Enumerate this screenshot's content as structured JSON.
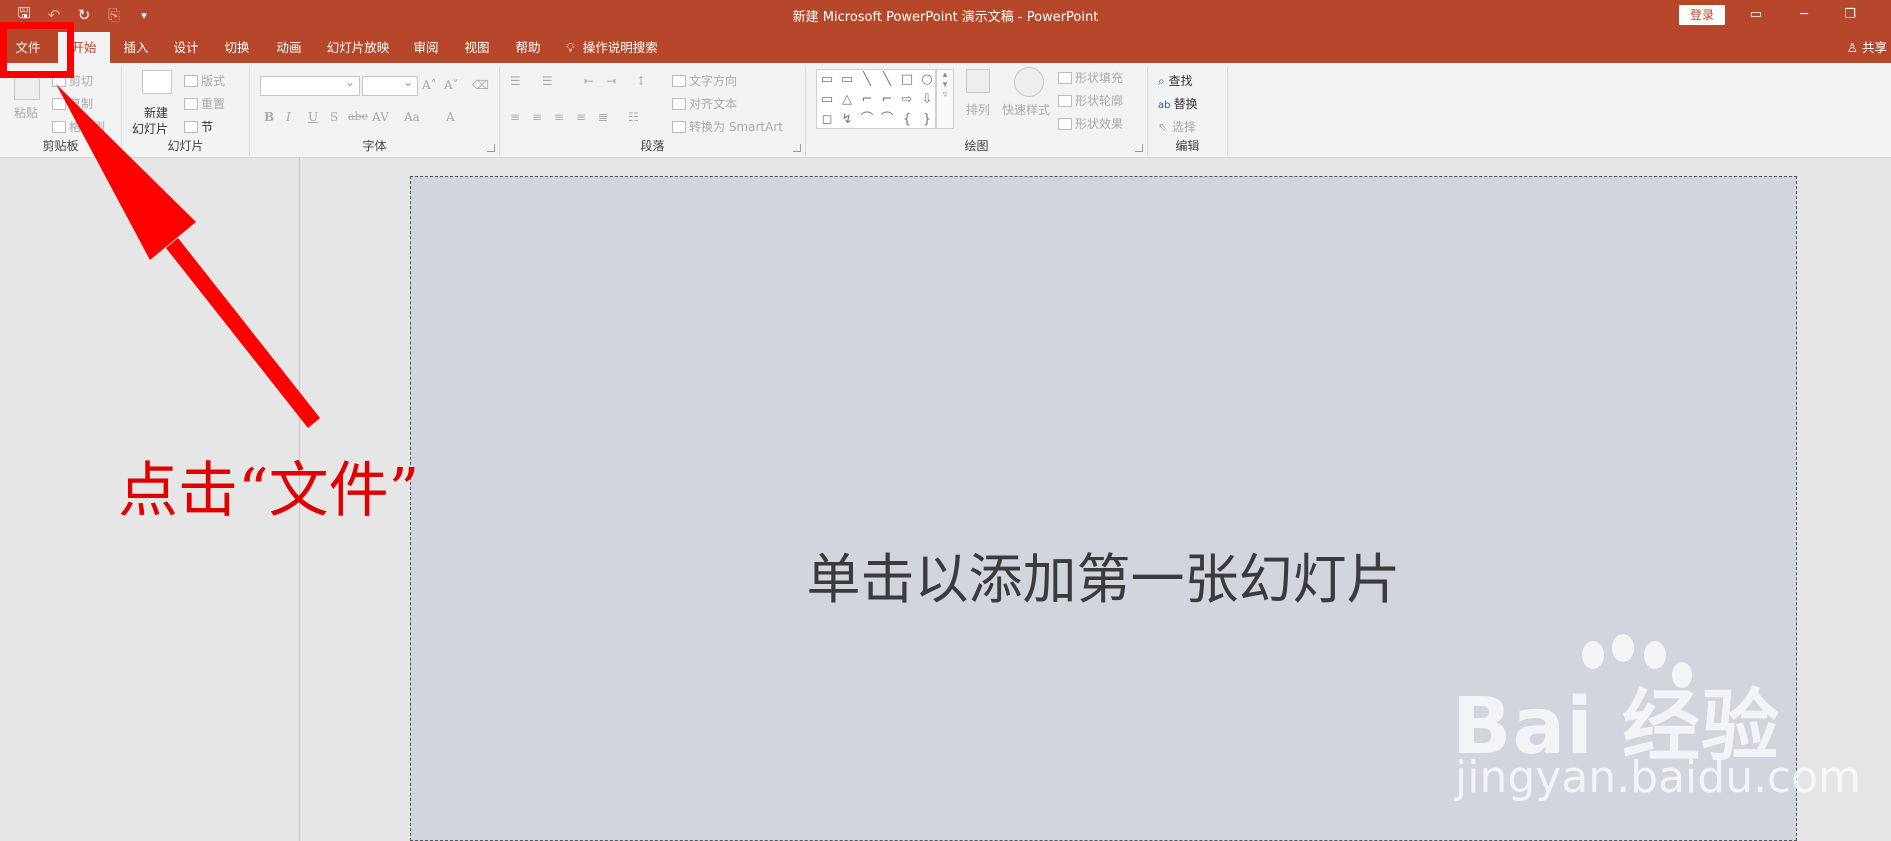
{
  "window": {
    "title": "新建 Microsoft PowerPoint 演示文稿 - PowerPoint",
    "login_label": "登录",
    "minimize": "─",
    "restore": "❐",
    "ribbon_display": "▭"
  },
  "qat": {
    "save_icon": "🖫",
    "undo_icon": "↶",
    "redo_icon": "↻",
    "start_icon": "⎘",
    "customize_icon": "▾"
  },
  "tabs": [
    {
      "label": "文件"
    },
    {
      "label": "开始"
    },
    {
      "label": "插入"
    },
    {
      "label": "设计"
    },
    {
      "label": "切换"
    },
    {
      "label": "动画"
    },
    {
      "label": "幻灯片放映"
    },
    {
      "label": "审阅"
    },
    {
      "label": "视图"
    },
    {
      "label": "帮助"
    }
  ],
  "tell_me": {
    "icon": "lightbulb-icon",
    "label": "操作说明搜索"
  },
  "share_label": "共享",
  "ribbon": {
    "clipboard": {
      "label": "剪贴板",
      "paste": "粘贴",
      "cut": "剪切",
      "copy": "复制",
      "format_painter": "格式刷"
    },
    "slides": {
      "label": "幻灯片",
      "new_slide_line1": "新建",
      "new_slide_line2": "幻灯片",
      "layout": "版式",
      "reset": "重置",
      "section": "节"
    },
    "font": {
      "label": "字体",
      "increase": "A˄",
      "decrease": "A˅",
      "bold": "B",
      "italic": "I",
      "underline": "U",
      "shadow": "S",
      "strike": "abc",
      "spacing": "AV",
      "case": "Aa",
      "color": "A"
    },
    "paragraph": {
      "label": "段落",
      "text_direction": "文字方向",
      "align_text": "对齐文本",
      "smartart": "转换为 SmartArt"
    },
    "drawing": {
      "label": "绘图",
      "arrange": "排列",
      "quick_styles": "快速样式",
      "shape_fill": "形状填充",
      "shape_outline": "形状轮廓",
      "shape_effects": "形状效果",
      "shapes": [
        "▭",
        "▭",
        "╲",
        "╲",
        "□",
        "○",
        "▭",
        "△",
        "⌐",
        "⌐",
        "⇨",
        "⇩",
        "◻",
        "↯",
        "⌒",
        "⌒",
        "{",
        "}"
      ]
    },
    "editing": {
      "label": "编辑",
      "find": "查找",
      "replace": "替换",
      "select": "选择"
    }
  },
  "slide": {
    "placeholder": "单击以添加第一张幻灯片"
  },
  "annotation": {
    "text": "点击“文件”"
  },
  "watermark": {
    "logo": "Bai  经验",
    "url": "jingyan.baidu.com"
  },
  "colors": {
    "brand": "#b7472a",
    "annotation": "#ff0000"
  }
}
